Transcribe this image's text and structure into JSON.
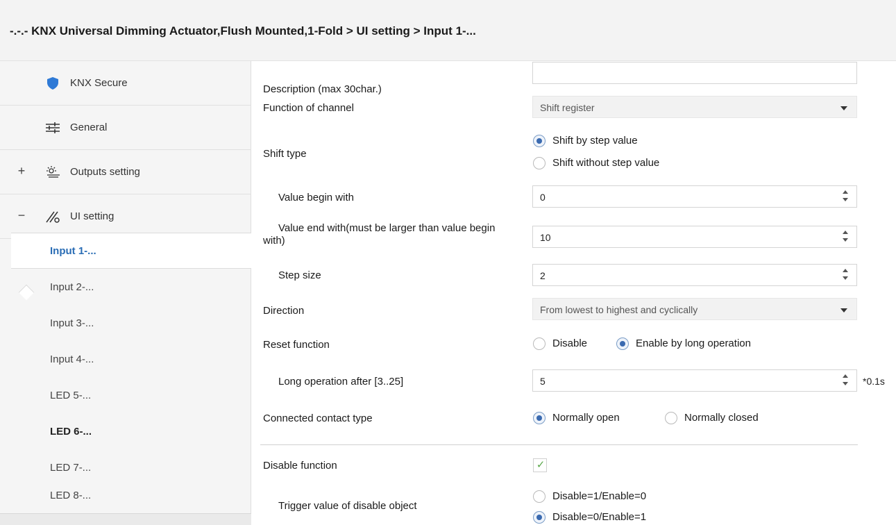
{
  "title": "-.-.- KNX Universal Dimming Actuator,Flush Mounted,1-Fold > UI setting > Input 1-...",
  "sidebar": {
    "items": [
      {
        "expander": "",
        "icon": "shield-icon",
        "label": "KNX Secure"
      },
      {
        "expander": "",
        "icon": "sliders-icon",
        "label": "General"
      },
      {
        "expander": "+",
        "icon": "lamp-icon",
        "label": "Outputs setting"
      },
      {
        "expander": "−",
        "icon": "ui-settings-icon",
        "label": "UI setting"
      }
    ],
    "subitems": [
      {
        "label": "Input 1-...",
        "state": "active"
      },
      {
        "label": "Input 2-...",
        "state": ""
      },
      {
        "label": "Input 3-...",
        "state": ""
      },
      {
        "label": "Input 4-...",
        "state": ""
      },
      {
        "label": "LED 5-...",
        "state": ""
      },
      {
        "label": "LED 6-...",
        "state": "bold"
      },
      {
        "label": "LED 7-...",
        "state": ""
      },
      {
        "label": "LED 8-...",
        "state": ""
      }
    ]
  },
  "form": {
    "description": {
      "label": "Description (max 30char.)",
      "value": ""
    },
    "function": {
      "label": "Function of channel",
      "value": "Shift register"
    },
    "shift_type": {
      "label": "Shift type",
      "options": [
        "Shift by step value",
        "Shift without step value"
      ],
      "selected": 0
    },
    "value_begin": {
      "label": "Value begin with",
      "value": "0"
    },
    "value_end": {
      "label": "Value end with(must be larger than value begin with)",
      "value": "10"
    },
    "step_size": {
      "label": "Step  size",
      "value": "2"
    },
    "direction": {
      "label": "Direction",
      "value": "From lowest to highest and cyclically"
    },
    "reset": {
      "label": "Reset function",
      "options": [
        "Disable",
        "Enable by long operation"
      ],
      "selected": 1
    },
    "long_op": {
      "label": "Long operation after [3..25]",
      "value": "5",
      "unit": "*0.1s"
    },
    "contact": {
      "label": "Connected contact type",
      "options": [
        "Normally open",
        "Normally closed"
      ],
      "selected": 0
    },
    "disable_function": {
      "label": "Disable function",
      "checked": true
    },
    "trigger": {
      "label": "Trigger value of disable object",
      "options": [
        "Disable=1/Enable=0",
        "Disable=0/Enable=1"
      ],
      "selected": 1
    }
  },
  "colors": {
    "accent": "#2a6db5",
    "check": "#5aa84a",
    "radio_selected": "#3a6ab0"
  }
}
